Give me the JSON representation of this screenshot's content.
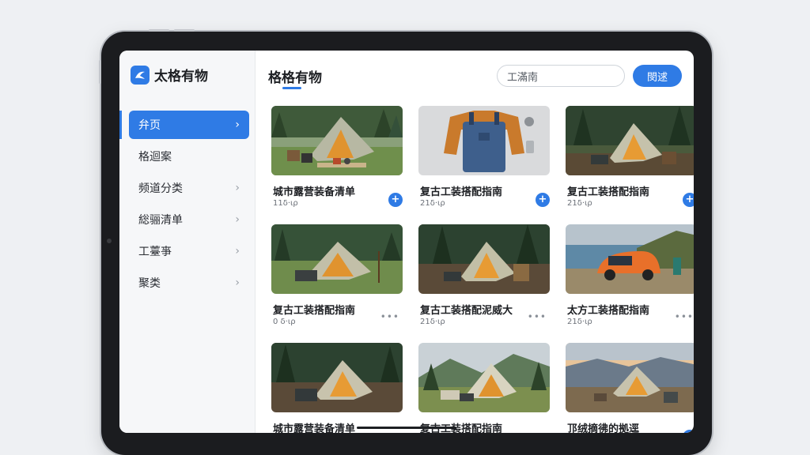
{
  "app": {
    "name": "太格有物"
  },
  "sidebar": {
    "items": [
      {
        "label": "弁页",
        "active": true
      },
      {
        "label": "格迴案",
        "active": false,
        "chevron": false
      },
      {
        "label": "频道分类",
        "active": false,
        "chevron": true
      },
      {
        "label": "総骊清单",
        "active": false,
        "chevron": true
      },
      {
        "label": "工薹亊",
        "active": false,
        "chevron": true
      },
      {
        "label": "聚类",
        "active": false,
        "chevron": true
      }
    ]
  },
  "main": {
    "title": "格格有物",
    "search": {
      "value": "工滿南"
    },
    "search_button": "閔逑"
  },
  "cards": [
    {
      "title": "城市露营装备清单",
      "meta": "11δ·ιρ",
      "action": "plus",
      "scene": "forest-tent-gear"
    },
    {
      "title": "复古工装搭配指南",
      "meta": "21δ·ιρ",
      "action": "plus",
      "scene": "workwear"
    },
    {
      "title": "复古工装搭配指南",
      "meta": "21δ·ιρ",
      "action": "plus",
      "scene": "forest-tent"
    },
    {
      "title": "复古工装搭配指南",
      "meta": "0 δ·ιρ",
      "action": "more",
      "scene": "forest-tent"
    },
    {
      "title": "复古工装搭配泥威大",
      "meta": "21δ·ιρ",
      "action": "more",
      "scene": "forest-tent"
    },
    {
      "title": "太方工装搭配指南",
      "meta": "21δ·ιρ",
      "action": "more",
      "scene": "coast-car"
    },
    {
      "title": "城市露营装备清单",
      "meta": "",
      "action": "none",
      "scene": "forest-tent"
    },
    {
      "title": "复古工装搭配指南",
      "meta": "",
      "action": "more",
      "scene": "mountain-tent"
    },
    {
      "title": "邒绒摘彿的拠逕",
      "meta": "",
      "action": "plus",
      "scene": "sunset-tent"
    }
  ],
  "colors": {
    "accent": "#2f7be5",
    "sidebar_bg": "#f6f7f9"
  }
}
